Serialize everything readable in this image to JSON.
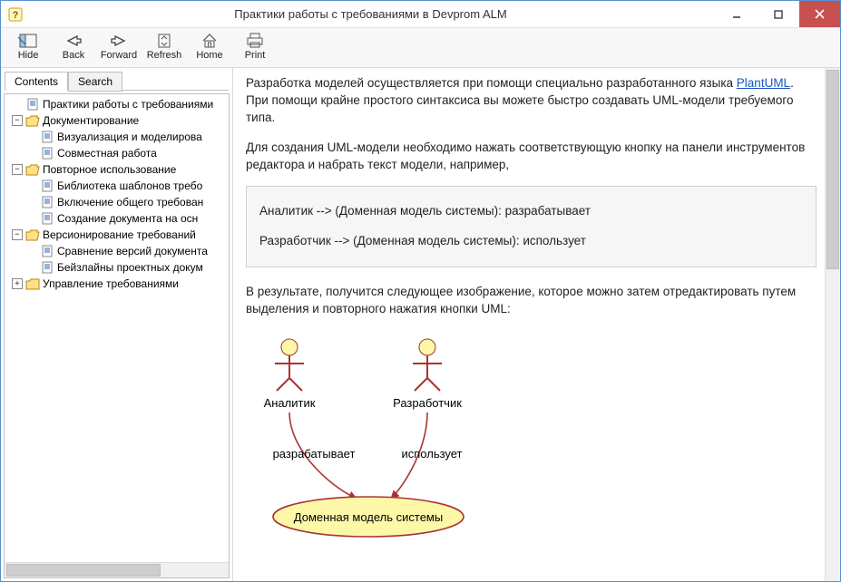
{
  "window": {
    "title": "Практики работы с требованиями в Devprom ALM"
  },
  "toolbar": {
    "hide": "Hide",
    "back": "Back",
    "forward": "Forward",
    "refresh": "Refresh",
    "home": "Home",
    "print": "Print"
  },
  "sidebar": {
    "tabs": {
      "contents": "Contents",
      "search": "Search"
    },
    "tree": {
      "root": "Практики работы с требованиями",
      "f_doc": "Документирование",
      "doc_vis": "Визуализация и моделирова",
      "doc_collab": "Совместная работа",
      "f_reuse": "Повторное использование",
      "reuse_lib": "Библиотека шаблонов требо",
      "reuse_incl": "Включение общего требован",
      "reuse_create": "Создание документа на осн",
      "f_version": "Версионирование требований",
      "ver_compare": "Сравнение версий документа",
      "ver_base": "Бейзлайны проектных докум",
      "f_manage": "Управление требованиями"
    }
  },
  "content": {
    "para1_a": "Разработка моделей осуществляется при помощи специально разработанного языка ",
    "link": "PlantUML",
    "para1_b": ". При помощи крайне простого синтаксиса вы можете быстро создавать UML-модели требуемого типа.",
    "para2": "Для создания UML-модели необходимо нажать соответствующую кнопку на панели инструментов редактора и набрать текст модели, например,",
    "code1": "Аналитик --> (Доменная модель системы): разрабатывает",
    "code2": "Разработчик --> (Доменная модель системы): использует",
    "para3": "В результате, получится следующее изображение, которое можно затем отредактировать путем выделения и повторного нажатия кнопки UML:",
    "uml": {
      "actor1": "Аналитик",
      "actor2": "Разработчик",
      "rel1": "разрабатывает",
      "rel2": "использует",
      "usecase": "Доменная модель системы"
    }
  }
}
